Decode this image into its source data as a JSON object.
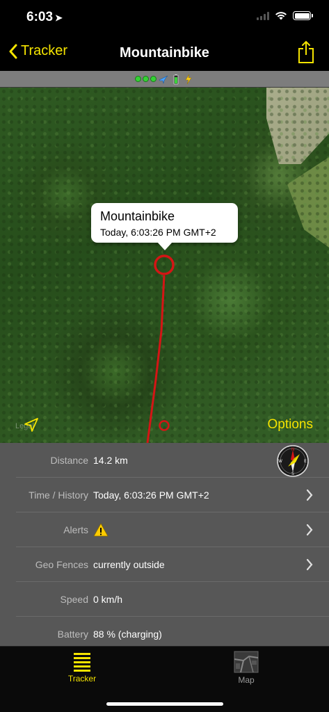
{
  "status_bar": {
    "time": "6:03",
    "location_arrow": "location-arrow-icon"
  },
  "nav": {
    "back_label": "Tracker",
    "title": "Mountainbike",
    "share_icon": "share-icon"
  },
  "indicators": [
    "green-dot",
    "green-dot",
    "green-dot",
    "airplane-icon",
    "battery-green-icon",
    "bolt-icon"
  ],
  "map": {
    "callout_title": "Mountainbike",
    "callout_subtitle": "Today, 6:03:26 PM GMT+2",
    "legal": "Legal",
    "options_label": "Options",
    "track_color": "#d41515"
  },
  "details": {
    "rows": [
      {
        "label": "Distance",
        "value": "14.2 km"
      },
      {
        "label": "Time / History",
        "value": "Today, 6:03:26 PM GMT+2"
      },
      {
        "label": "Alerts",
        "value": ""
      },
      {
        "label": "Geo Fences",
        "value": "currently outside"
      },
      {
        "label": "Speed",
        "value": "0 km/h"
      },
      {
        "label": "Battery",
        "value": "88 % (charging)"
      }
    ]
  },
  "tabs": [
    {
      "label": "Tracker",
      "selected": true
    },
    {
      "label": "Map",
      "selected": false
    }
  ],
  "colors": {
    "accent": "#f5e400",
    "panel": "#575757",
    "background": "#000000"
  }
}
